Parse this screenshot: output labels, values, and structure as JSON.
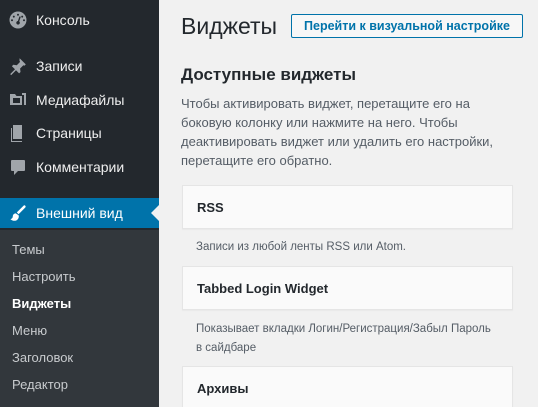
{
  "sidebar": {
    "items": [
      {
        "label": "Консоль",
        "icon": "dashboard-icon"
      },
      {
        "label": "Записи",
        "icon": "pushpin-icon"
      },
      {
        "label": "Медиафайлы",
        "icon": "media-icon"
      },
      {
        "label": "Страницы",
        "icon": "pages-icon"
      },
      {
        "label": "Комментарии",
        "icon": "comment-icon"
      },
      {
        "label": "Внешний вид",
        "icon": "paintbrush-icon"
      }
    ],
    "submenu": [
      {
        "label": "Темы"
      },
      {
        "label": "Настроить"
      },
      {
        "label": "Виджеты"
      },
      {
        "label": "Меню"
      },
      {
        "label": "Заголовок"
      },
      {
        "label": "Редактор"
      }
    ]
  },
  "main": {
    "title": "Виджеты",
    "title_action": "Перейти к визуальной настройке",
    "section_heading": "Доступные виджеты",
    "description": "Чтобы активировать виджет, перетащите его на боковую колонку или нажмите на него. Чтобы деактивировать виджет или удалить его настройки, перетащите его обратно.",
    "widgets": [
      {
        "title": "RSS",
        "description": "Записи из любой ленты RSS или Atom."
      },
      {
        "title": "Tabbed Login Widget",
        "description": "Показывает вкладки Логин/Регистрация/Забыл Пароль в сайдбаре"
      },
      {
        "title": "Архивы"
      }
    ]
  },
  "colors": {
    "sidebar_bg": "#23282d",
    "submenu_bg": "#32373c",
    "accent": "#0073aa",
    "page_bg": "#f1f1f1"
  }
}
